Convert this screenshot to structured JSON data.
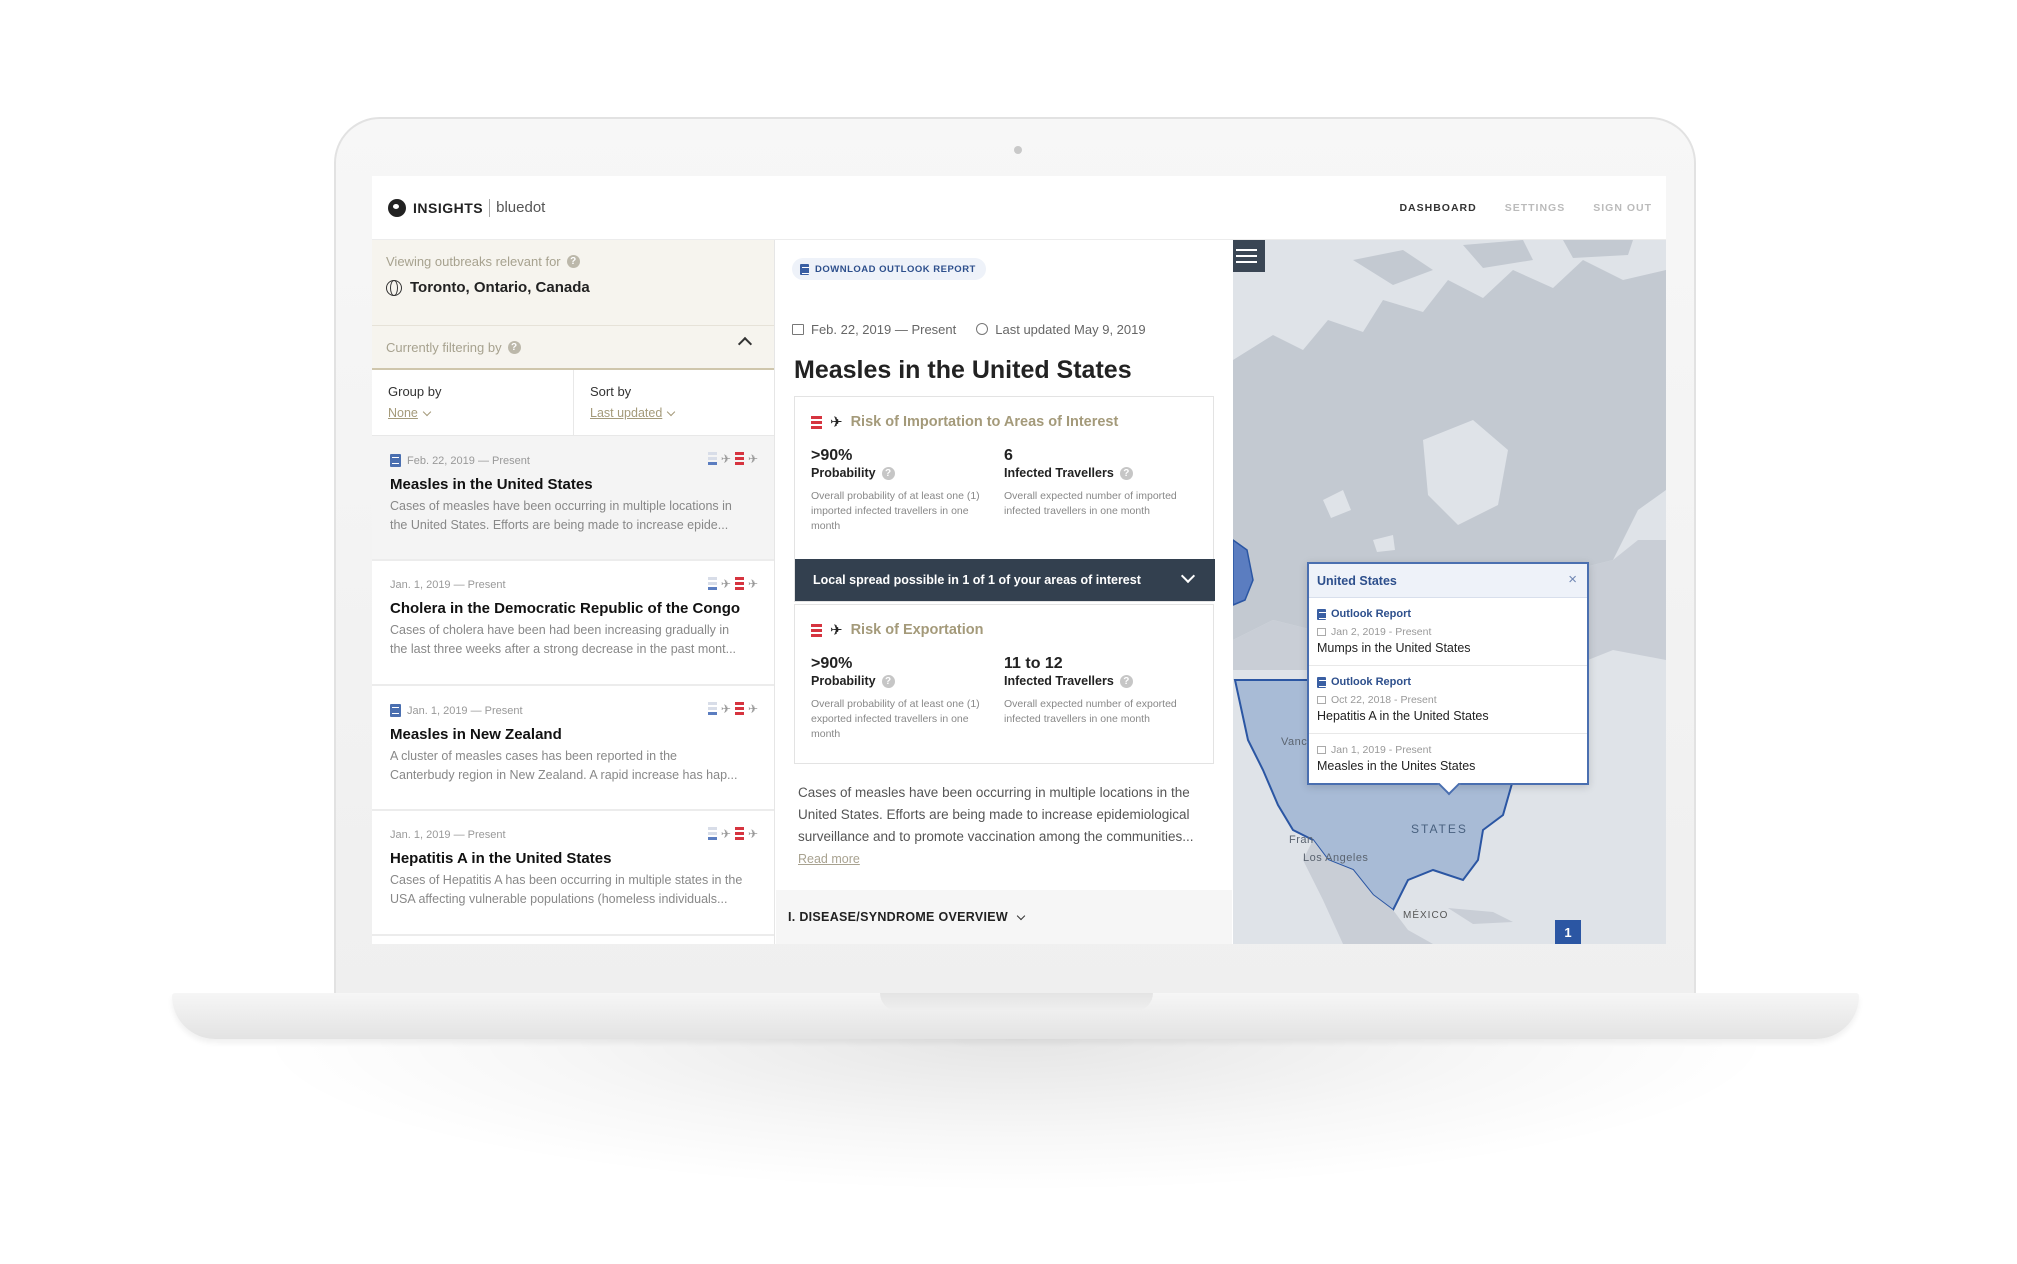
{
  "header": {
    "brand": "INSIGHTS",
    "brand_sub": "bluedot",
    "nav": [
      "DASHBOARD",
      "SETTINGS",
      "SIGN OUT"
    ]
  },
  "sidebar": {
    "viewing_label": "Viewing outbreaks relevant for",
    "location": "Toronto, Ontario, Canada",
    "filter_label": "Currently filtering by",
    "group_by_label": "Group by",
    "group_by_value": "None",
    "sort_by_label": "Sort by",
    "sort_by_value": "Last updated",
    "events": [
      {
        "date": "Feb. 22, 2019 — Present",
        "title": "Measles in the United States",
        "desc_1": "Cases of measles have been occurring in multiple locations in",
        "desc_2": "the United States. Efforts are being made to increase epide..."
      },
      {
        "date": "Jan. 1, 2019 — Present",
        "title": "Cholera in the Democratic Republic of the Congo",
        "desc_1": "Cases of cholera have been had been increasing gradually in",
        "desc_2": "the last three weeks after a strong decrease in the past mont..."
      },
      {
        "date": "Jan. 1, 2019 — Present",
        "title": "Measles in New Zealand",
        "desc_1": "A cluster of measles cases has been reported in the",
        "desc_2": "Canterbudy region in New Zealand. A rapid increase has hap..."
      },
      {
        "date": "Jan. 1, 2019 — Present",
        "title": "Hepatitis A in the United States",
        "desc_1": "Cases of Hepatitis A has been occurring in multiple states in the",
        "desc_2": "USA affecting vulnerable populations (homeless individuals..."
      }
    ]
  },
  "detail": {
    "download_label": "DOWNLOAD OUTLOOK REPORT",
    "date_range": "Feb. 22, 2019 — Present",
    "last_updated": "Last updated May 9, 2019",
    "title": "Measles in the United States",
    "importation": {
      "title": "Risk of Importation to Areas of Interest",
      "probability_value": ">90%",
      "probability_label": "Probability",
      "probability_note": "Overall probability of at least one (1) imported infected travellers in one month",
      "travellers_value": "6",
      "travellers_label": "Infected Travellers",
      "travellers_note": "Overall expected number of imported infected travellers in one month"
    },
    "local_spread": "Local spread possible in 1 of 1 of your areas of interest",
    "exportation": {
      "title": "Risk of Exportation",
      "probability_value": ">90%",
      "probability_label": "Probability",
      "probability_note": "Overall probability of at least one (1) exported infected travellers in one month",
      "travellers_value": "11 to 12",
      "travellers_label": "Infected Travellers",
      "travellers_note": "Overall expected number of exported infected travellers in one month"
    },
    "summary": "Cases of measles have been occurring in multiple locations in the United States. Efforts are being made to increase epidemiological surveillance and to promote vaccination among the communities...",
    "read_more": "Read more",
    "section_title": "I. DISEASE/SYNDROME OVERVIEW"
  },
  "map": {
    "popup_title": "United States",
    "popup_close": "×",
    "popup_items": [
      {
        "type": "Outlook Report",
        "date": "Jan 2, 2019 - Present",
        "title": "Mumps in the United States"
      },
      {
        "type": "Outlook Report",
        "date": "Oct 22, 2018 - Present",
        "title": "Hepatitis A in the United States"
      },
      {
        "type": "",
        "date": "Jan 1, 2019 - Present",
        "title": "Measles in the Unites States"
      }
    ],
    "label_states": "STATES",
    "label_mexico": "MÉXICO",
    "label_la": "Los Angeles",
    "label_fr": "Fran",
    "label_van": "Vanc",
    "cluster_count": "1"
  },
  "colors": {
    "accent_blue": "#2b56a3",
    "risk_red": "#d6343f",
    "gold_text": "#a49a7a",
    "dark_banner": "#33404f"
  }
}
